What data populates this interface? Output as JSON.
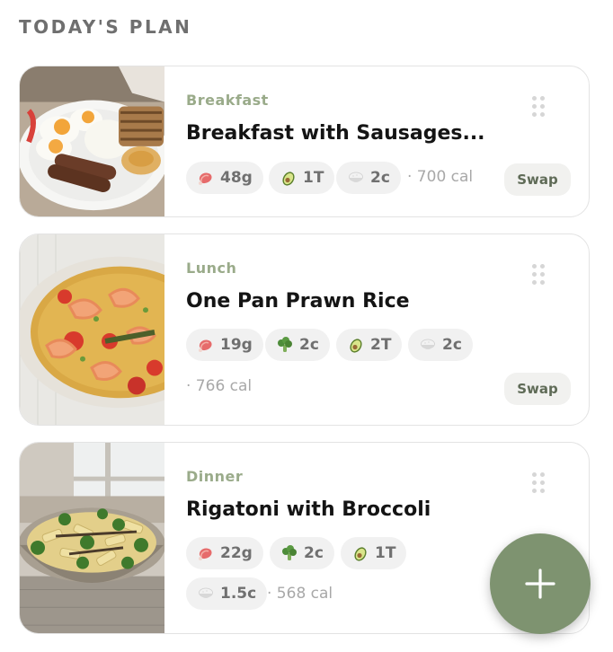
{
  "section": {
    "title": "TODAY'S PLAN"
  },
  "meals": [
    {
      "type": "Breakfast",
      "title": "Breakfast with Sausages...",
      "protein": "48g",
      "fat": "1T",
      "carbs": "2c",
      "calories": "· 700 cal",
      "swap_label": "Swap"
    },
    {
      "type": "Lunch",
      "title": "One Pan Prawn Rice",
      "protein": "19g",
      "veg": "2c",
      "fat": "2T",
      "carbs": "2c",
      "calories": "· 766 cal",
      "swap_label": "Swap"
    },
    {
      "type": "Dinner",
      "title": "Rigatoni with Broccoli",
      "protein": "22g",
      "veg": "2c",
      "fat": "1T",
      "carbs": "1.5c",
      "calories": "· 568 cal"
    }
  ],
  "icons": {
    "protein": "meat-icon",
    "veg": "broccoli-icon",
    "fat": "avocado-icon",
    "carbs": "grain-bowl-icon",
    "drag": "drag-handle-icon",
    "add": "plus-icon"
  },
  "colors": {
    "accent": "#7e9370",
    "meal_type": "#9aab8a",
    "pill_bg": "#f1f1f1"
  }
}
